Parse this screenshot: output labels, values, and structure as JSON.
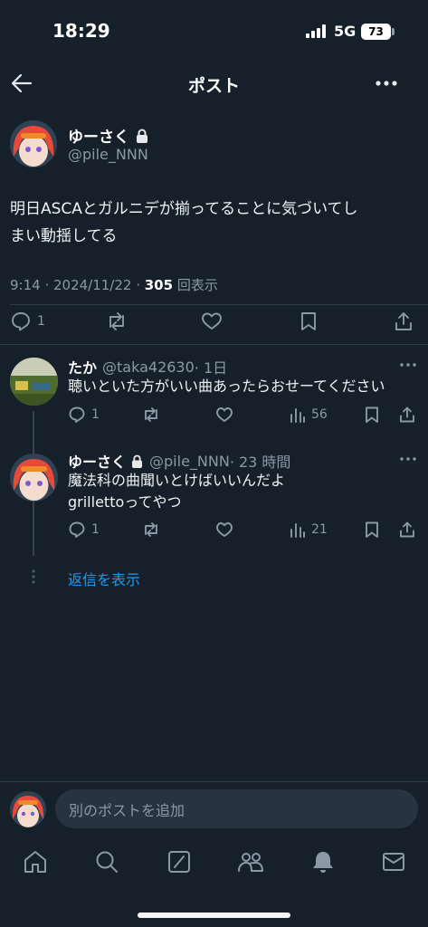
{
  "status_bar": {
    "time": "18:29",
    "network": "5G",
    "battery": "73"
  },
  "header": {
    "title": "ポスト"
  },
  "main_post": {
    "author_name": "ゆーさく",
    "author_handle": "@pile_NNN",
    "text_line1": "明日ASCAとガルニデが揃ってることに気づいてし",
    "text_line2": "まい動揺してる",
    "time": "9:14 · 2024/11/22 · ",
    "views_count": "305",
    "views_label": " 回表示",
    "reply_count": "1"
  },
  "replies": [
    {
      "name": "たか",
      "handle": "@taka42630",
      "time": " · 1日",
      "text_line1": "聴いといた方がいい曲あったらおせーてください",
      "text_line2": "",
      "reply_count": "1",
      "views": "56"
    },
    {
      "name": "ゆーさく",
      "handle": "@pile_NNN",
      "time": " · 23 時間",
      "text_line1": "魔法科の曲聞いとけばいいんだよ",
      "text_line2": "grillettoってやつ",
      "reply_count": "1",
      "views": "21"
    }
  ],
  "show_replies": "返信を表示",
  "composer": {
    "placeholder": "別のポストを追加"
  },
  "colors": {
    "background": "#15202b",
    "accent": "#1d9bf0",
    "muted": "#8b98a5"
  }
}
